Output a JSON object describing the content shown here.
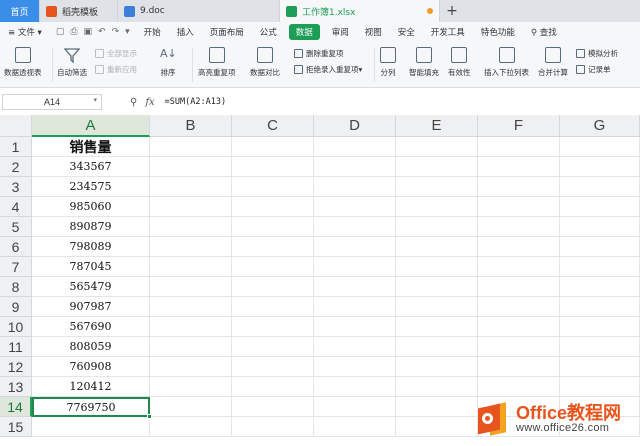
{
  "tabs": {
    "home": "首页",
    "t1": "稻壳模板",
    "t2": "9.doc",
    "t3": "工作簿1.xlsx"
  },
  "menu": {
    "file": "文件",
    "items": [
      "开始",
      "插入",
      "页面布局",
      "公式",
      "数据",
      "审阅",
      "视图",
      "安全",
      "开发工具",
      "特色功能"
    ],
    "active_index": 4,
    "search": "查找"
  },
  "ribbon": {
    "pivot": "数据透视表",
    "autofilter": "自动筛选",
    "show_all": "全部显示",
    "reapply": "重新应用",
    "sort": "排序",
    "highlight_dup": "高亮重复项",
    "compare": "数据对比",
    "remove_dup": "删除重复项",
    "reject_dup": "拒绝录入重复项",
    "split": "分列",
    "smart_fill": "智能填充",
    "validity": "有效性",
    "dropdown": "插入下拉列表",
    "merge_calc": "合并计算",
    "simulate": "模拟分析",
    "record": "记录单"
  },
  "formula_bar": {
    "name_box": "A14",
    "fx": "fx",
    "formula": "=SUM(A2:A13)"
  },
  "sheet": {
    "columns": [
      "A",
      "B",
      "C",
      "D",
      "E",
      "F",
      "G"
    ],
    "rows": [
      "1",
      "2",
      "3",
      "4",
      "5",
      "6",
      "7",
      "8",
      "9",
      "10",
      "11",
      "12",
      "13",
      "14",
      "15"
    ],
    "col_a": [
      "销售量",
      "343567",
      "234575",
      "985060",
      "890879",
      "798089",
      "787045",
      "565479",
      "907987",
      "567690",
      "808059",
      "760908",
      "120412",
      "7769750",
      ""
    ],
    "active_cell": "A14"
  },
  "watermark": {
    "brand": "Office教程网",
    "url": "www.office26.com"
  },
  "colors": {
    "accent": "#1d9e57",
    "home_tab": "#3b8ee8",
    "logo_orange": "#e8541d"
  }
}
